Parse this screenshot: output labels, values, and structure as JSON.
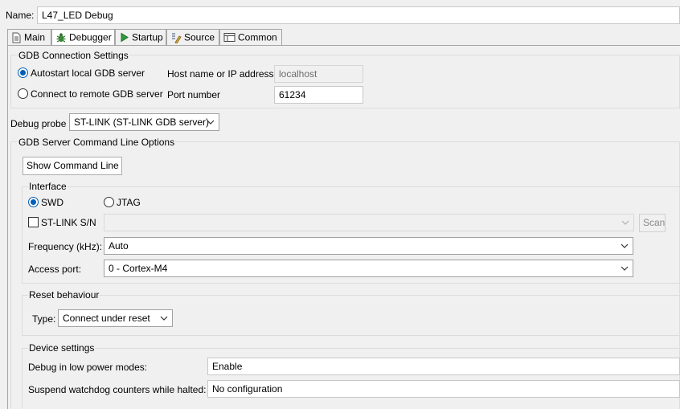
{
  "name_field": {
    "label": "Name:",
    "value": "L47_LED Debug"
  },
  "tabs": [
    {
      "label": "Main",
      "icon": "document-icon"
    },
    {
      "label": "Debugger",
      "icon": "bug-icon"
    },
    {
      "label": "Startup",
      "icon": "play-icon"
    },
    {
      "label": "Source",
      "icon": "source-icon"
    },
    {
      "label": "Common",
      "icon": "table-icon"
    }
  ],
  "active_tab": "Debugger",
  "gdb_connection": {
    "title": "GDB Connection Settings",
    "autostart_label": "Autostart local GDB server",
    "remote_label": "Connect to remote GDB server",
    "selected": "autostart",
    "host_label": "Host name or IP address",
    "host_value": "localhost",
    "port_label": "Port number",
    "port_value": "61234"
  },
  "debug_probe": {
    "label": "Debug probe",
    "value": "ST-LINK (ST-LINK GDB server)"
  },
  "server_options": {
    "title": "GDB Server Command Line Options",
    "show_command_line_button": "Show Command Line",
    "interface": {
      "title": "Interface",
      "swd_label": "SWD",
      "jtag_label": "JTAG",
      "selected": "SWD",
      "stlink_sn_label": "ST-LINK S/N",
      "stlink_sn_checked": false,
      "stlink_sn_value": "",
      "scan_button": "Scan",
      "frequency_label": "Frequency (kHz):",
      "frequency_value": "Auto",
      "access_port_label": "Access port:",
      "access_port_value": "0 - Cortex-M4"
    },
    "reset": {
      "title": "Reset behaviour",
      "type_label": "Type:",
      "type_value": "Connect under reset"
    },
    "device": {
      "title": "Device settings",
      "low_power_label": "Debug in low power modes:",
      "low_power_value": "Enable",
      "watchdog_label": "Suspend watchdog counters while halted:",
      "watchdog_value": "No configuration"
    }
  },
  "colors": {
    "accent": "#005fb8",
    "background": "#f0f0f0",
    "tab_border": "#a5a5a5"
  }
}
